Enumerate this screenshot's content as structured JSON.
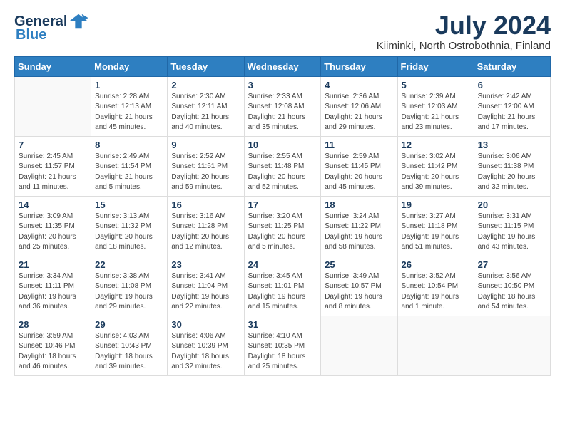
{
  "header": {
    "logo_general": "General",
    "logo_blue": "Blue",
    "month_title": "July 2024",
    "subtitle": "Kiiminki, North Ostrobothnia, Finland"
  },
  "weekdays": [
    "Sunday",
    "Monday",
    "Tuesday",
    "Wednesday",
    "Thursday",
    "Friday",
    "Saturday"
  ],
  "weeks": [
    [
      {
        "day": "",
        "info": ""
      },
      {
        "day": "1",
        "info": "Sunrise: 2:28 AM\nSunset: 12:13 AM\nDaylight: 21 hours\nand 45 minutes."
      },
      {
        "day": "2",
        "info": "Sunrise: 2:30 AM\nSunset: 12:11 AM\nDaylight: 21 hours\nand 40 minutes."
      },
      {
        "day": "3",
        "info": "Sunrise: 2:33 AM\nSunset: 12:08 AM\nDaylight: 21 hours\nand 35 minutes."
      },
      {
        "day": "4",
        "info": "Sunrise: 2:36 AM\nSunset: 12:06 AM\nDaylight: 21 hours\nand 29 minutes."
      },
      {
        "day": "5",
        "info": "Sunrise: 2:39 AM\nSunset: 12:03 AM\nDaylight: 21 hours\nand 23 minutes."
      },
      {
        "day": "6",
        "info": "Sunrise: 2:42 AM\nSunset: 12:00 AM\nDaylight: 21 hours\nand 17 minutes."
      }
    ],
    [
      {
        "day": "7",
        "info": "Sunrise: 2:45 AM\nSunset: 11:57 PM\nDaylight: 21 hours\nand 11 minutes."
      },
      {
        "day": "8",
        "info": "Sunrise: 2:49 AM\nSunset: 11:54 PM\nDaylight: 21 hours\nand 5 minutes."
      },
      {
        "day": "9",
        "info": "Sunrise: 2:52 AM\nSunset: 11:51 PM\nDaylight: 20 hours\nand 59 minutes."
      },
      {
        "day": "10",
        "info": "Sunrise: 2:55 AM\nSunset: 11:48 PM\nDaylight: 20 hours\nand 52 minutes."
      },
      {
        "day": "11",
        "info": "Sunrise: 2:59 AM\nSunset: 11:45 PM\nDaylight: 20 hours\nand 45 minutes."
      },
      {
        "day": "12",
        "info": "Sunrise: 3:02 AM\nSunset: 11:42 PM\nDaylight: 20 hours\nand 39 minutes."
      },
      {
        "day": "13",
        "info": "Sunrise: 3:06 AM\nSunset: 11:38 PM\nDaylight: 20 hours\nand 32 minutes."
      }
    ],
    [
      {
        "day": "14",
        "info": "Sunrise: 3:09 AM\nSunset: 11:35 PM\nDaylight: 20 hours\nand 25 minutes."
      },
      {
        "day": "15",
        "info": "Sunrise: 3:13 AM\nSunset: 11:32 PM\nDaylight: 20 hours\nand 18 minutes."
      },
      {
        "day": "16",
        "info": "Sunrise: 3:16 AM\nSunset: 11:28 PM\nDaylight: 20 hours\nand 12 minutes."
      },
      {
        "day": "17",
        "info": "Sunrise: 3:20 AM\nSunset: 11:25 PM\nDaylight: 20 hours\nand 5 minutes."
      },
      {
        "day": "18",
        "info": "Sunrise: 3:24 AM\nSunset: 11:22 PM\nDaylight: 19 hours\nand 58 minutes."
      },
      {
        "day": "19",
        "info": "Sunrise: 3:27 AM\nSunset: 11:18 PM\nDaylight: 19 hours\nand 51 minutes."
      },
      {
        "day": "20",
        "info": "Sunrise: 3:31 AM\nSunset: 11:15 PM\nDaylight: 19 hours\nand 43 minutes."
      }
    ],
    [
      {
        "day": "21",
        "info": "Sunrise: 3:34 AM\nSunset: 11:11 PM\nDaylight: 19 hours\nand 36 minutes."
      },
      {
        "day": "22",
        "info": "Sunrise: 3:38 AM\nSunset: 11:08 PM\nDaylight: 19 hours\nand 29 minutes."
      },
      {
        "day": "23",
        "info": "Sunrise: 3:41 AM\nSunset: 11:04 PM\nDaylight: 19 hours\nand 22 minutes."
      },
      {
        "day": "24",
        "info": "Sunrise: 3:45 AM\nSunset: 11:01 PM\nDaylight: 19 hours\nand 15 minutes."
      },
      {
        "day": "25",
        "info": "Sunrise: 3:49 AM\nSunset: 10:57 PM\nDaylight: 19 hours\nand 8 minutes."
      },
      {
        "day": "26",
        "info": "Sunrise: 3:52 AM\nSunset: 10:54 PM\nDaylight: 19 hours\nand 1 minute."
      },
      {
        "day": "27",
        "info": "Sunrise: 3:56 AM\nSunset: 10:50 PM\nDaylight: 18 hours\nand 54 minutes."
      }
    ],
    [
      {
        "day": "28",
        "info": "Sunrise: 3:59 AM\nSunset: 10:46 PM\nDaylight: 18 hours\nand 46 minutes."
      },
      {
        "day": "29",
        "info": "Sunrise: 4:03 AM\nSunset: 10:43 PM\nDaylight: 18 hours\nand 39 minutes."
      },
      {
        "day": "30",
        "info": "Sunrise: 4:06 AM\nSunset: 10:39 PM\nDaylight: 18 hours\nand 32 minutes."
      },
      {
        "day": "31",
        "info": "Sunrise: 4:10 AM\nSunset: 10:35 PM\nDaylight: 18 hours\nand 25 minutes."
      },
      {
        "day": "",
        "info": ""
      },
      {
        "day": "",
        "info": ""
      },
      {
        "day": "",
        "info": ""
      }
    ]
  ]
}
